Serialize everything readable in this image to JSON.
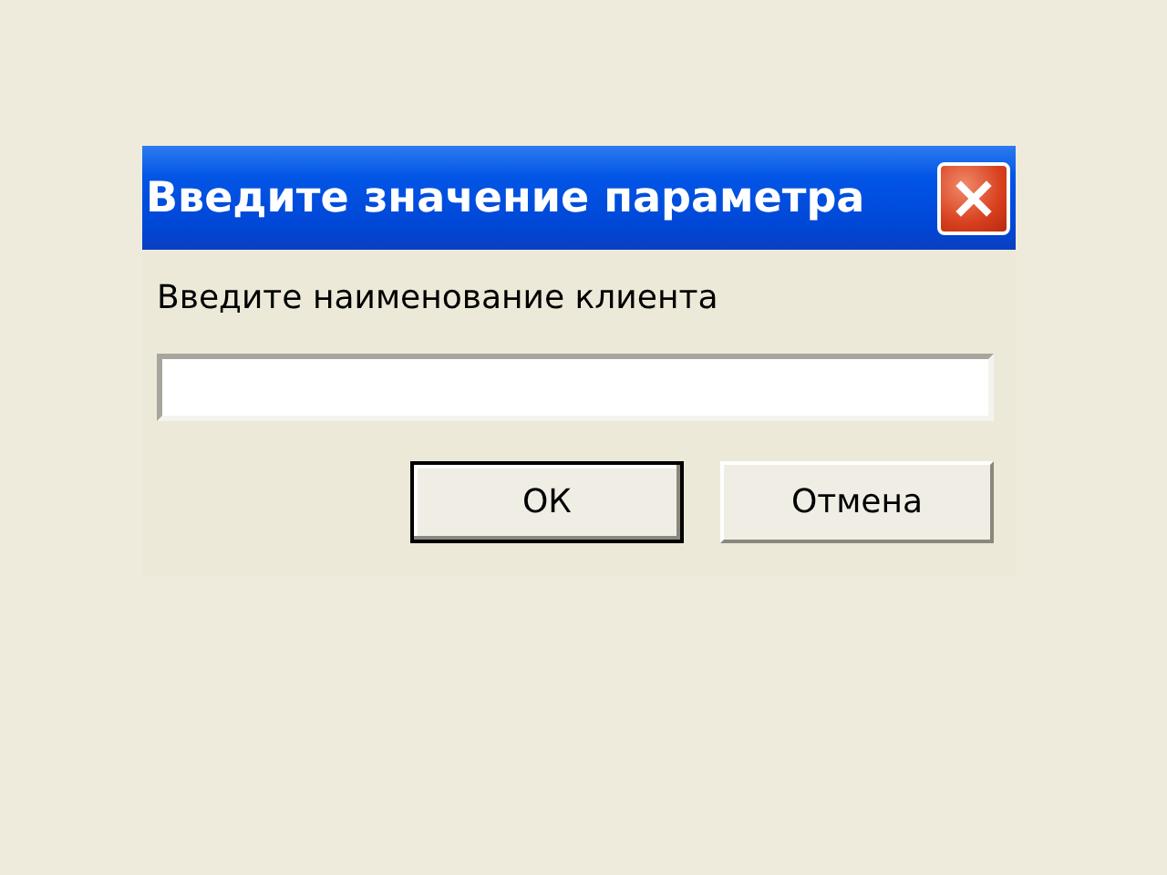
{
  "window": {
    "title": "Введите значение параметра"
  },
  "prompt": "Введите наименование клиента",
  "buttons": [
    {
      "label": "ОК",
      "default": true
    },
    {
      "label": "Отмена",
      "default": false
    }
  ]
}
